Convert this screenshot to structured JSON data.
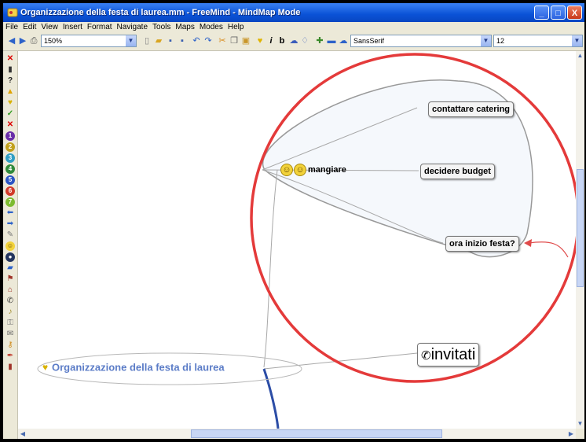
{
  "window": {
    "title": "Organizzazione della festa di laurea.mm - FreeMind - MindMap Mode",
    "buttons": {
      "minimize": "_",
      "maximize": "□",
      "close": "X"
    }
  },
  "menu": [
    "File",
    "Edit",
    "View",
    "Insert",
    "Format",
    "Navigate",
    "Tools",
    "Maps",
    "Modes",
    "Help"
  ],
  "toolbar": {
    "zoom": "150%",
    "font_family": "SansSerif",
    "font_size": "12"
  },
  "mindmap": {
    "root": "Organizzazione della festa di laurea",
    "mangiare": "mangiare",
    "contattare": "contattare catering",
    "budget": "decidere budget",
    "ora": "ora inizio festa?",
    "invitati": "invitati"
  },
  "colors": {
    "highlight_circle": "#e43a3a",
    "root_text": "#5b7cc7",
    "edge": "#a8a8a8",
    "thick_edge": "#2c4da6"
  }
}
